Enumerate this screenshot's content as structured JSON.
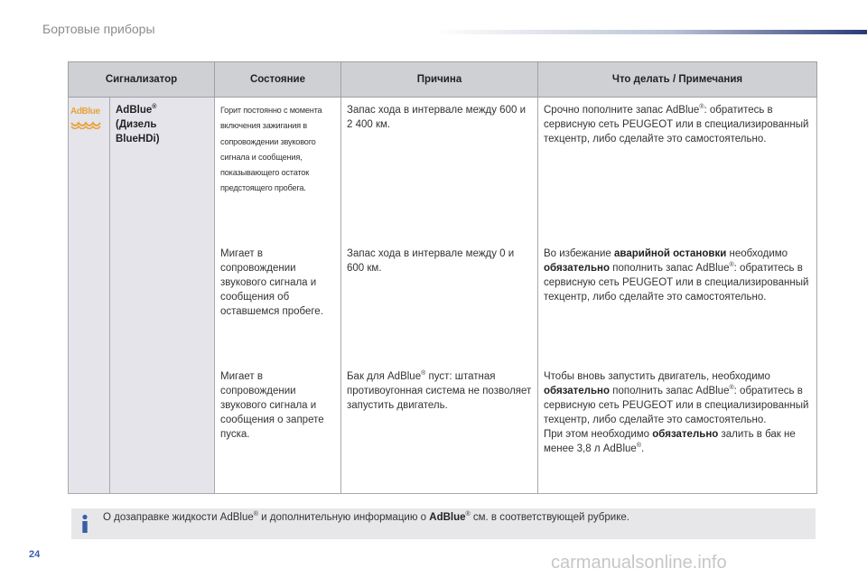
{
  "header": {
    "section_title": "Бортовые приборы"
  },
  "table": {
    "columns": [
      "Сигнализатор",
      "Состояние",
      "Причина",
      "Что делать / Примечания"
    ],
    "indicator": {
      "logo_text": "AdBlue",
      "name_main": "AdBlue",
      "reg_mark": "®",
      "name_line2": "(Дизель",
      "name_line3": "BlueHDi)"
    },
    "rows": [
      {
        "state": "Горит постоянно с момента включения зажигания в сопровождении звукового сигнала и сообщения, показывающего остаток предстоящего пробега.",
        "cause": "Запас хода в интервале между 600 и 2 400 км.",
        "action_a": "Срочно пополните запас AdBlue",
        "action_b": ": обратитесь в сервисную сеть PEUGEOT или в специализированный техцентр, либо сделайте это самостоятельно."
      },
      {
        "state": "Мигает в сопровождении звукового сигнала и сообщения об оставшемся пробеге.",
        "cause": "Запас хода в интервале между 0 и 600 км.",
        "action_a": "Во избежание ",
        "action_b": "аварийной остановки",
        "action_c": " необходимо ",
        "action_d": "обязательно",
        "action_e": " пополнить запас AdBlue",
        "action_f": ": обратитесь в сервисную сеть PEUGEOT или в специализированный техцентр, либо сделайте это самостоятельно."
      },
      {
        "state": "Мигает в сопровождении звукового сигнала и сообщения о запрете пуска.",
        "cause_a": "Бак для AdBlue",
        "cause_b": " пуст: штатная противоугонная система не позволяет запустить двигатель.",
        "action_a": "Чтобы вновь запустить двигатель, необходимо ",
        "action_b": "обязательно",
        "action_c": " пополнить запас AdBlue",
        "action_d": ": обратитесь в сервисную сеть PEUGEOT или в специализированный техцентр, либо сделайте это самостоятельно.",
        "action_e": "При этом необходимо ",
        "action_f": "обязательно",
        "action_g": " залить в бак не менее 3,8 л AdBlue",
        "action_h": "."
      }
    ]
  },
  "note": {
    "icon": "info-icon",
    "text_a": "О дозаправке жидкости AdBlue",
    "text_b": " и дополнительную информацию о ",
    "text_c": "AdBlue",
    "text_d": " см. в соответствующей рубрике."
  },
  "footer": {
    "page_number": "24",
    "watermark": "carmanualsonline.info"
  },
  "colors": {
    "accent": "#3a5ea8",
    "logo_orange": "#e8a33c",
    "header_bg": "#cfd0d3",
    "row_bg": "#e4e4ea"
  }
}
